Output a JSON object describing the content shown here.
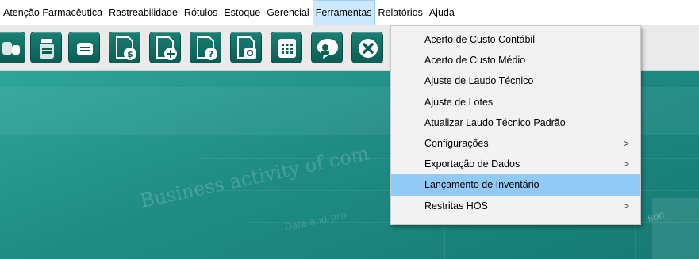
{
  "menubar": {
    "items": [
      {
        "label": "Atenção Farmacêutica"
      },
      {
        "label": "Rastreabilidade"
      },
      {
        "label": "Rótulos"
      },
      {
        "label": "Estoque"
      },
      {
        "label": "Gerencial"
      },
      {
        "label": "Ferramentas"
      },
      {
        "label": "Relatórios"
      },
      {
        "label": "Ajuda"
      }
    ]
  },
  "toolbar": {
    "buttons": [
      {
        "icon": "pills-icon"
      },
      {
        "icon": "medicine-bottle-icon"
      },
      {
        "icon": "label-icon"
      },
      {
        "icon": "document-dollar-icon"
      },
      {
        "icon": "document-add-icon"
      },
      {
        "icon": "document-help-icon"
      },
      {
        "icon": "document-search-icon"
      },
      {
        "icon": "calculator-icon"
      },
      {
        "icon": "chat-user-icon"
      },
      {
        "icon": "close-icon"
      }
    ]
  },
  "dropdown": {
    "items": [
      {
        "label": "Acerto de Custo Contábil",
        "submenu": false,
        "highlight": false
      },
      {
        "label": "Acerto de Custo Médio",
        "submenu": false,
        "highlight": false
      },
      {
        "label": "Ajuste de Laudo Técnico",
        "submenu": false,
        "highlight": false
      },
      {
        "label": "Ajuste de Lotes",
        "submenu": false,
        "highlight": false
      },
      {
        "label": "Atualizar Laudo Técnico Padrão",
        "submenu": false,
        "highlight": false
      },
      {
        "label": "Configurações",
        "submenu": true,
        "highlight": false
      },
      {
        "label": "Exportação de Dados",
        "submenu": true,
        "highlight": false
      },
      {
        "label": "Lançamento de Inventário",
        "submenu": false,
        "highlight": true
      },
      {
        "label": "Restritas HOS",
        "submenu": true,
        "highlight": false
      }
    ],
    "submenu_arrow": ">"
  },
  "background": {
    "text_large": "Business activity of com",
    "text_small": "Data and pro",
    "text_number": "600"
  },
  "colors": {
    "menu_active_bg": "#cce8ff",
    "dropdown_highlight": "#91c9f7",
    "toolbar_button": "#0b5e55",
    "background_teal": "#1f8c84"
  }
}
